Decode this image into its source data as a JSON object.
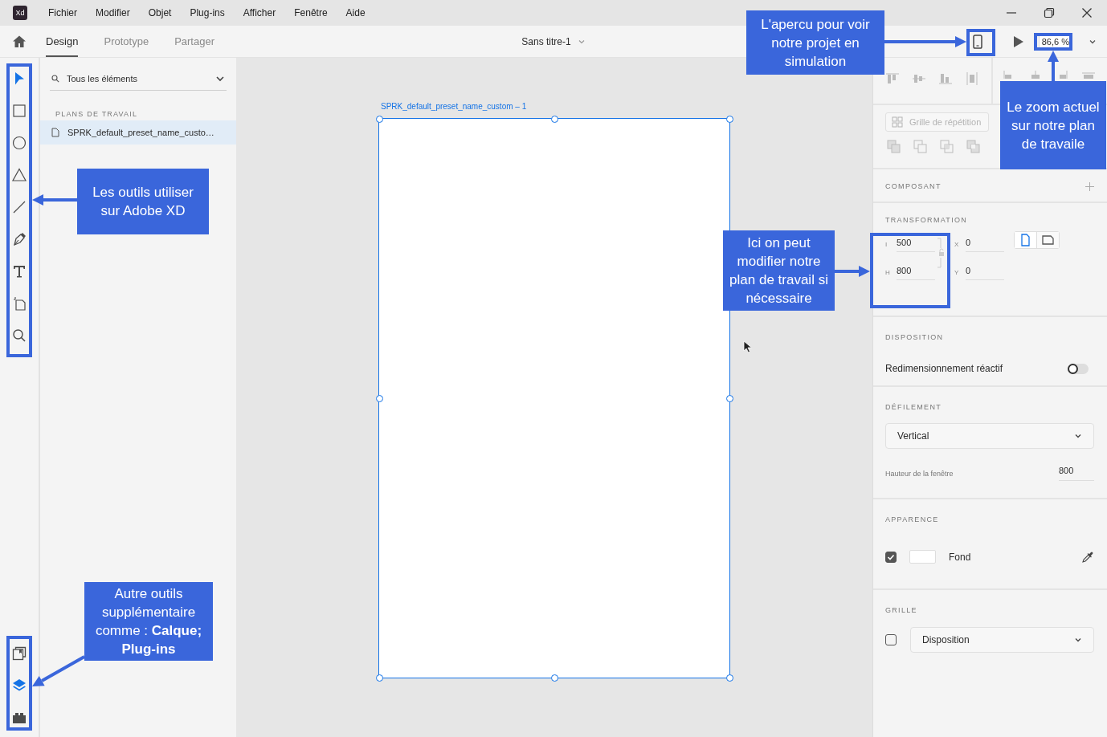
{
  "app_logo": "Xd",
  "menu": [
    "Fichier",
    "Modifier",
    "Objet",
    "Plug-ins",
    "Afficher",
    "Fenêtre",
    "Aide"
  ],
  "tabs": [
    {
      "label": "Design",
      "selected": true
    },
    {
      "label": "Prototype",
      "selected": false
    },
    {
      "label": "Partager",
      "selected": false
    }
  ],
  "document_title": "Sans titre-1",
  "zoom": "86,6 %",
  "tools": [
    {
      "kind": "select",
      "selected": true
    },
    {
      "kind": "rectangle",
      "selected": false
    },
    {
      "kind": "ellipse",
      "selected": false
    },
    {
      "kind": "polygon",
      "selected": false
    },
    {
      "kind": "line",
      "selected": false
    },
    {
      "kind": "pen",
      "selected": false
    },
    {
      "kind": "text",
      "selected": false
    },
    {
      "kind": "artboard",
      "selected": false
    },
    {
      "kind": "zoom",
      "selected": false
    }
  ],
  "panel_tools": [
    {
      "kind": "assets",
      "selected": false
    },
    {
      "kind": "layers",
      "selected": true
    },
    {
      "kind": "plugins",
      "selected": false
    }
  ],
  "layers_panel": {
    "search": "Tous les éléments",
    "section": "PLANS DE TRAVAIL",
    "items": [
      {
        "label": "SPRK_default_preset_name_custo…",
        "selected": true
      }
    ]
  },
  "canvas": {
    "artboard_label": "SPRK_default_preset_name_custom – 1"
  },
  "inspector": {
    "repeat_grid": {
      "label": "Grille de répétition",
      "disabled": true
    },
    "component": {
      "heading": "COMPOSANT"
    },
    "transform": {
      "heading": "TRANSFORMATION",
      "fields": [
        {
          "label": "I",
          "value": "500"
        },
        {
          "label": "X",
          "value": "0"
        },
        {
          "label": "H",
          "value": "800"
        },
        {
          "label": "Y",
          "value": "0"
        }
      ],
      "orientations": [
        {
          "kind": "portrait",
          "selected": true
        },
        {
          "kind": "landscape",
          "selected": false
        }
      ]
    },
    "layout": {
      "heading": "DISPOSITION",
      "label": "Redimensionnement réactif",
      "on": false
    },
    "scrolling": {
      "heading": "DÉFILEMENT",
      "value": "Vertical",
      "viewport_label": "Hauteur de la fenêtre",
      "viewport_value": "800"
    },
    "appearance": {
      "heading": "APPARENCE",
      "checked": true,
      "label": "Fond"
    },
    "grid": {
      "heading": "GRILLE",
      "checked": false,
      "value": "Disposition"
    }
  },
  "annotations": [
    {
      "kind": "preview",
      "text": "L'apercu pour voir notre projet en simulation"
    },
    {
      "kind": "zoom",
      "text": "Le zoom actuel sur notre plan de travaile"
    },
    {
      "kind": "tools",
      "text": "Les outils utiliser sur Adobe XD"
    },
    {
      "kind": "size",
      "text": "Ici on peut modifier notre plan de travail si nécessaire"
    },
    {
      "kind": "panels",
      "text": "Autre outils supplémentaire comme : **Calque; Plug-ins**"
    }
  ]
}
